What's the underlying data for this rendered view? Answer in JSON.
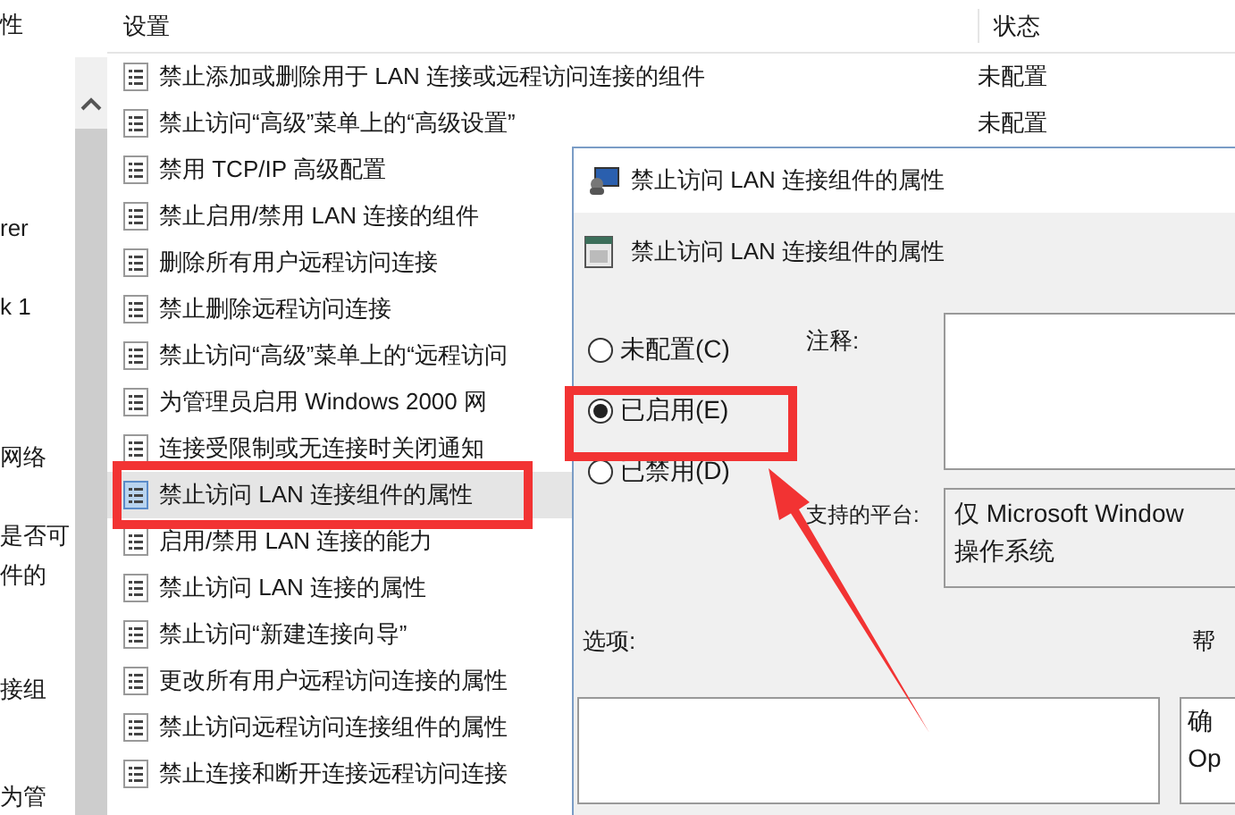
{
  "tree": {
    "items": [
      "性",
      "rer",
      "k 1",
      "网络",
      "是否可",
      "件的",
      "接组",
      "为管"
    ]
  },
  "list": {
    "columns": [
      "设置",
      "状态"
    ],
    "rows": [
      {
        "name": "禁止添加或删除用于 LAN 连接或远程访问连接的组件",
        "state": "未配置",
        "selected": false
      },
      {
        "name": "禁止访问“高级”菜单上的“高级设置”",
        "state": "未配置",
        "selected": false
      },
      {
        "name": "禁用 TCP/IP 高级配置",
        "selected": false
      },
      {
        "name": "禁止启用/禁用 LAN 连接的组件",
        "selected": false
      },
      {
        "name": "删除所有用户远程访问连接",
        "selected": false
      },
      {
        "name": "禁止删除远程访问连接",
        "selected": false
      },
      {
        "name": "禁止访问“高级”菜单上的“远程访问",
        "selected": false
      },
      {
        "name": "为管理员启用 Windows 2000 网",
        "selected": false
      },
      {
        "name": "连接受限制或无连接时关闭通知",
        "selected": false
      },
      {
        "name": "禁止访问 LAN 连接组件的属性",
        "selected": true
      },
      {
        "name": "启用/禁用 LAN 连接的能力",
        "selected": false
      },
      {
        "name": "禁止访问 LAN 连接的属性",
        "selected": false
      },
      {
        "name": "禁止访问“新建连接向导”",
        "selected": false
      },
      {
        "name": "更改所有用户远程访问连接的属性",
        "selected": false
      },
      {
        "name": "禁止访问远程访问连接组件的属性",
        "selected": false
      },
      {
        "name": "禁止连接和断开连接远程访问连接",
        "selected": false
      }
    ]
  },
  "dialog": {
    "title": "禁止访问 LAN 连接组件的属性",
    "heading": "禁止访问 LAN 连接组件的属性",
    "options": [
      {
        "label": "未配置(C)",
        "selected": false
      },
      {
        "label": "已启用(E)",
        "selected": true
      },
      {
        "label": "已禁用(D)",
        "selected": false
      }
    ],
    "comment_label": "注释:",
    "platform_label": "支持的平台:",
    "platform_lines": [
      "仅 Microsoft Window",
      "操作系统"
    ],
    "options_label": "选项:",
    "help_label": "帮",
    "help_lines": [
      "确",
      "Op"
    ]
  }
}
